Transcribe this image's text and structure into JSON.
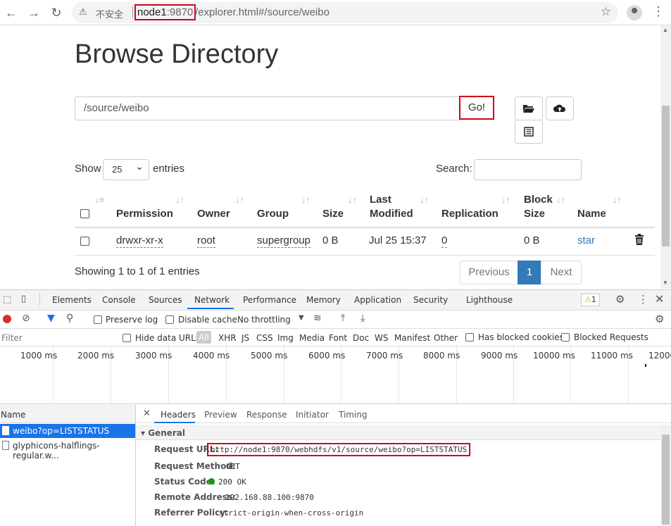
{
  "browser": {
    "insecure_label": "不安全",
    "host": "node1",
    "port": ":9870",
    "path": "/explorer.html#/source/weibo"
  },
  "page": {
    "title": "Browse Directory",
    "path_value": "/source/weibo",
    "go_label": "Go!",
    "show_label": "Show",
    "page_size": "25",
    "entries_label": "entries",
    "search_label": "Search:",
    "columns": [
      "Permission",
      "Owner",
      "Group",
      "Size",
      "Last",
      "Modified",
      "Replication",
      "Block",
      "Size",
      "Name"
    ],
    "row": {
      "permission": "drwxr-xr-x",
      "owner": "root",
      "group": "supergroup",
      "size": "0 B",
      "last_modified": "Jul 25 15:37",
      "replication": "0",
      "block_size": "0 B",
      "name": "star"
    },
    "showing": "Showing 1 to 1 of 1 entries",
    "prev_label": "Previous",
    "page_num": "1",
    "next_label": "Next"
  },
  "devtools": {
    "tabs": [
      "Elements",
      "Console",
      "Sources",
      "Network",
      "Performance",
      "Memory",
      "Application",
      "Security",
      "Lighthouse"
    ],
    "warning_count": "1",
    "preserve_log": "Preserve log",
    "disable_cache": "Disable cache",
    "throttling": "No throttling",
    "filter_placeholder": "Filter",
    "hide_data_urls": "Hide data URLs",
    "types": [
      "All",
      "XHR",
      "JS",
      "CSS",
      "Img",
      "Media",
      "Font",
      "Doc",
      "WS",
      "Manifest",
      "Other"
    ],
    "has_blocked": "Has blocked cookies",
    "blocked_requests": "Blocked Requests",
    "ticks": [
      "1000 ms",
      "2000 ms",
      "3000 ms",
      "4000 ms",
      "5000 ms",
      "6000 ms",
      "7000 ms",
      "8000 ms",
      "9000 ms",
      "10000 ms",
      "11000 ms",
      "12000"
    ],
    "name_header": "Name",
    "requests": [
      "weibo?op=LISTSTATUS",
      "glyphicons-halflings-regular.w..."
    ],
    "detail_tabs": [
      "Headers",
      "Preview",
      "Response",
      "Initiator",
      "Timing"
    ],
    "general_label": "▾ General",
    "general": {
      "request_url_label": "Request URL:",
      "request_url": "http://node1:9870/webhdfs/v1/source/weibo?op=LISTSTATUS",
      "method_label": "Request Method:",
      "method": "GET",
      "status_label": "Status Code:",
      "status": "200 OK",
      "remote_label": "Remote Address:",
      "remote": "192.168.88.100:9870",
      "referrer_label": "Referrer Policy:",
      "referrer": "strict-origin-when-cross-origin"
    }
  },
  "colors": {
    "accent": "#337ab7",
    "highlight": "#d0021b",
    "devtools_blue": "#1a73e8",
    "status_green": "#0a9e01"
  }
}
